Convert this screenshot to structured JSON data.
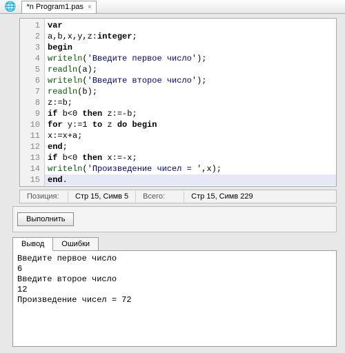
{
  "tab": {
    "title": "*n Program1.pas",
    "close_glyph": "×"
  },
  "tree_icon": "🌐",
  "code": {
    "lines": [
      {
        "n": 1,
        "tokens": [
          [
            "kw",
            "var"
          ]
        ]
      },
      {
        "n": 2,
        "tokens": [
          [
            "id",
            "a,b,x,y,z:"
          ],
          [
            "ty",
            "integer"
          ],
          [
            "id",
            ";"
          ]
        ]
      },
      {
        "n": 3,
        "tokens": [
          [
            "id",
            " "
          ],
          [
            "kw",
            "begin"
          ]
        ]
      },
      {
        "n": 4,
        "tokens": [
          [
            "fn",
            "writeln"
          ],
          [
            "id",
            "("
          ],
          [
            "str",
            "'Введите первое число'"
          ],
          [
            "id",
            ");"
          ]
        ]
      },
      {
        "n": 5,
        "tokens": [
          [
            "fn",
            "readln"
          ],
          [
            "id",
            "(a);"
          ]
        ]
      },
      {
        "n": 6,
        "tokens": [
          [
            "fn",
            "writeln"
          ],
          [
            "id",
            "("
          ],
          [
            "str",
            "'Введите второе число'"
          ],
          [
            "id",
            ");"
          ]
        ]
      },
      {
        "n": 7,
        "tokens": [
          [
            "fn",
            "readln"
          ],
          [
            "id",
            "(b);"
          ]
        ]
      },
      {
        "n": 8,
        "tokens": [
          [
            "id",
            "z:=b;"
          ]
        ]
      },
      {
        "n": 9,
        "tokens": [
          [
            "kw",
            "if"
          ],
          [
            "id",
            " b<0 "
          ],
          [
            "kw",
            "then"
          ],
          [
            "id",
            " z:=-b;"
          ]
        ]
      },
      {
        "n": 10,
        "tokens": [
          [
            "kw",
            "for"
          ],
          [
            "id",
            " y:=1 "
          ],
          [
            "kw",
            "to"
          ],
          [
            "id",
            " z "
          ],
          [
            "kw",
            "do"
          ],
          [
            "id",
            "  "
          ],
          [
            "kw",
            "begin"
          ]
        ]
      },
      {
        "n": 11,
        "tokens": [
          [
            "id",
            " x:=x+a;"
          ]
        ]
      },
      {
        "n": 12,
        "tokens": [
          [
            "id",
            " "
          ],
          [
            "kw",
            "end"
          ],
          [
            "id",
            ";"
          ]
        ]
      },
      {
        "n": 13,
        "tokens": [
          [
            "kw",
            "if"
          ],
          [
            "id",
            " b<0 "
          ],
          [
            "kw",
            "then"
          ],
          [
            "id",
            " x:=-x;"
          ]
        ]
      },
      {
        "n": 14,
        "tokens": [
          [
            "fn",
            "writeln"
          ],
          [
            "id",
            "("
          ],
          [
            "str",
            "'Произведение чисел = '"
          ],
          [
            "id",
            ",x);"
          ]
        ]
      },
      {
        "n": 15,
        "tokens": [
          [
            "kw",
            "end"
          ],
          [
            "id",
            "."
          ]
        ]
      }
    ],
    "highlighted_line": 15
  },
  "status": {
    "pos_label": "Позиция:",
    "pos_value": "Стр 15, Симв 5",
    "total_label": "Всего:",
    "total_value": "Стр 15, Симв 229"
  },
  "run_button": "Выполнить",
  "out_tabs": {
    "output": "Вывод",
    "errors": "Ошибки"
  },
  "output_text": "Введите первое число\n6\nВведите второе число\n12\nПроизведение чисел = 72"
}
